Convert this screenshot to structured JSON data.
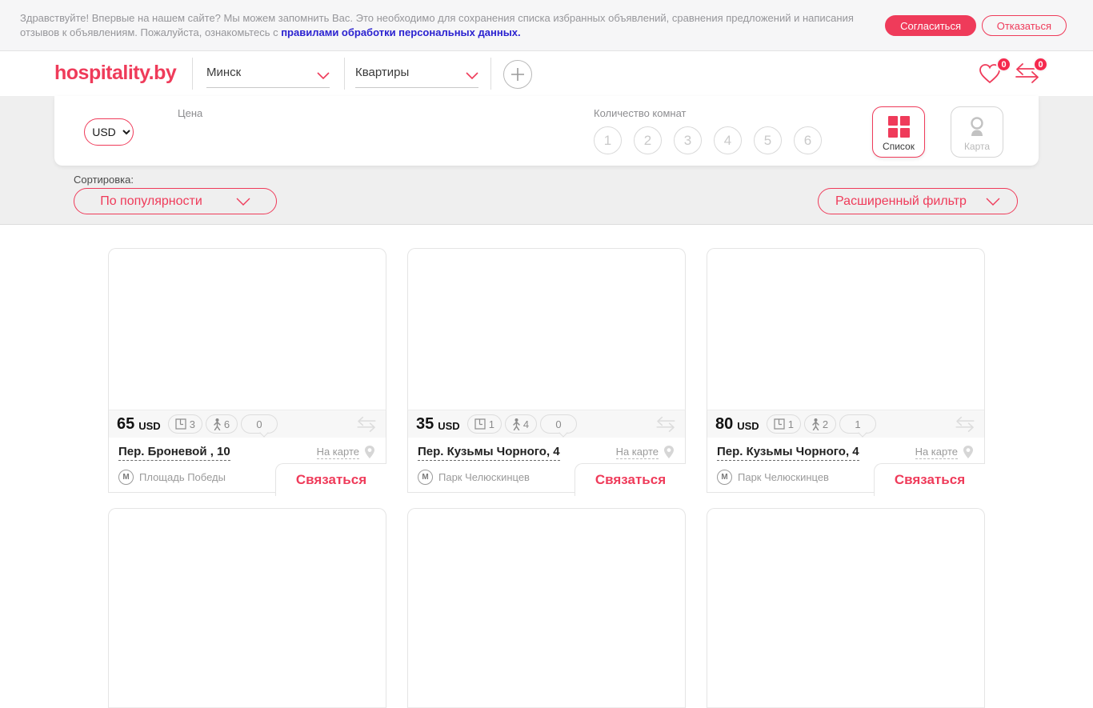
{
  "colors": {
    "accent": "#ef3b5a",
    "link_blue": "#2b22d0",
    "badge_red": "#f5294e"
  },
  "icons": {
    "favorites": "heart-icon",
    "compare": "swap-arrows-icon",
    "add": "plus-icon",
    "list_view": "grid-icon",
    "map_view": "map-pin-icon",
    "rooms": "floorplan-icon",
    "guests": "person-icon",
    "reviews": "speech-bubble-icon",
    "metro": "metro-m-icon"
  },
  "cookie_banner": {
    "message": "Здравствуйте! Впервые на нашем сайте? Мы можем запомнить Вас. Это необходимо для сохранения списка избранных объявлений, сравнения предложений и написания отзывов к объявлениям. Пожалуйста, ознакомьтесь с ",
    "link_text": "правилами обработки персональных данных.",
    "accept_label": "Согласиться",
    "decline_label": "Отказаться"
  },
  "header": {
    "logo": "hospitality.by",
    "city_selector": "Минск",
    "type_selector": "Квартиры",
    "favorites_count": "0",
    "compare_count": "0"
  },
  "filters": {
    "currency": "USD",
    "price_label": "Цена",
    "rooms_label": "Количество комнат",
    "room_options": [
      "1",
      "2",
      "3",
      "4",
      "5",
      "6"
    ],
    "view_list_label": "Список",
    "view_map_label": "Карта"
  },
  "sorting": {
    "label": "Сортировка:",
    "current": "По популярности",
    "advanced_filter_label": "Расширенный фильтр"
  },
  "listings": [
    {
      "price": "65",
      "currency": "USD",
      "rooms": "3",
      "guests": "6",
      "reviews": "0",
      "address": "Пер. Броневой , 10",
      "metro": "Площадь Победы",
      "map_link": "На карте",
      "contact_label": "Связаться"
    },
    {
      "price": "35",
      "currency": "USD",
      "rooms": "1",
      "guests": "4",
      "reviews": "0",
      "address": "Пер. Кузьмы Чорного, 4",
      "metro": "Парк Челюскинцев",
      "map_link": "На карте",
      "contact_label": "Связаться"
    },
    {
      "price": "80",
      "currency": "USD",
      "rooms": "1",
      "guests": "2",
      "reviews": "1",
      "address": "Пер. Кузьмы Чорного, 4",
      "metro": "Парк Челюскинцев",
      "map_link": "На карте",
      "contact_label": "Связаться"
    }
  ]
}
